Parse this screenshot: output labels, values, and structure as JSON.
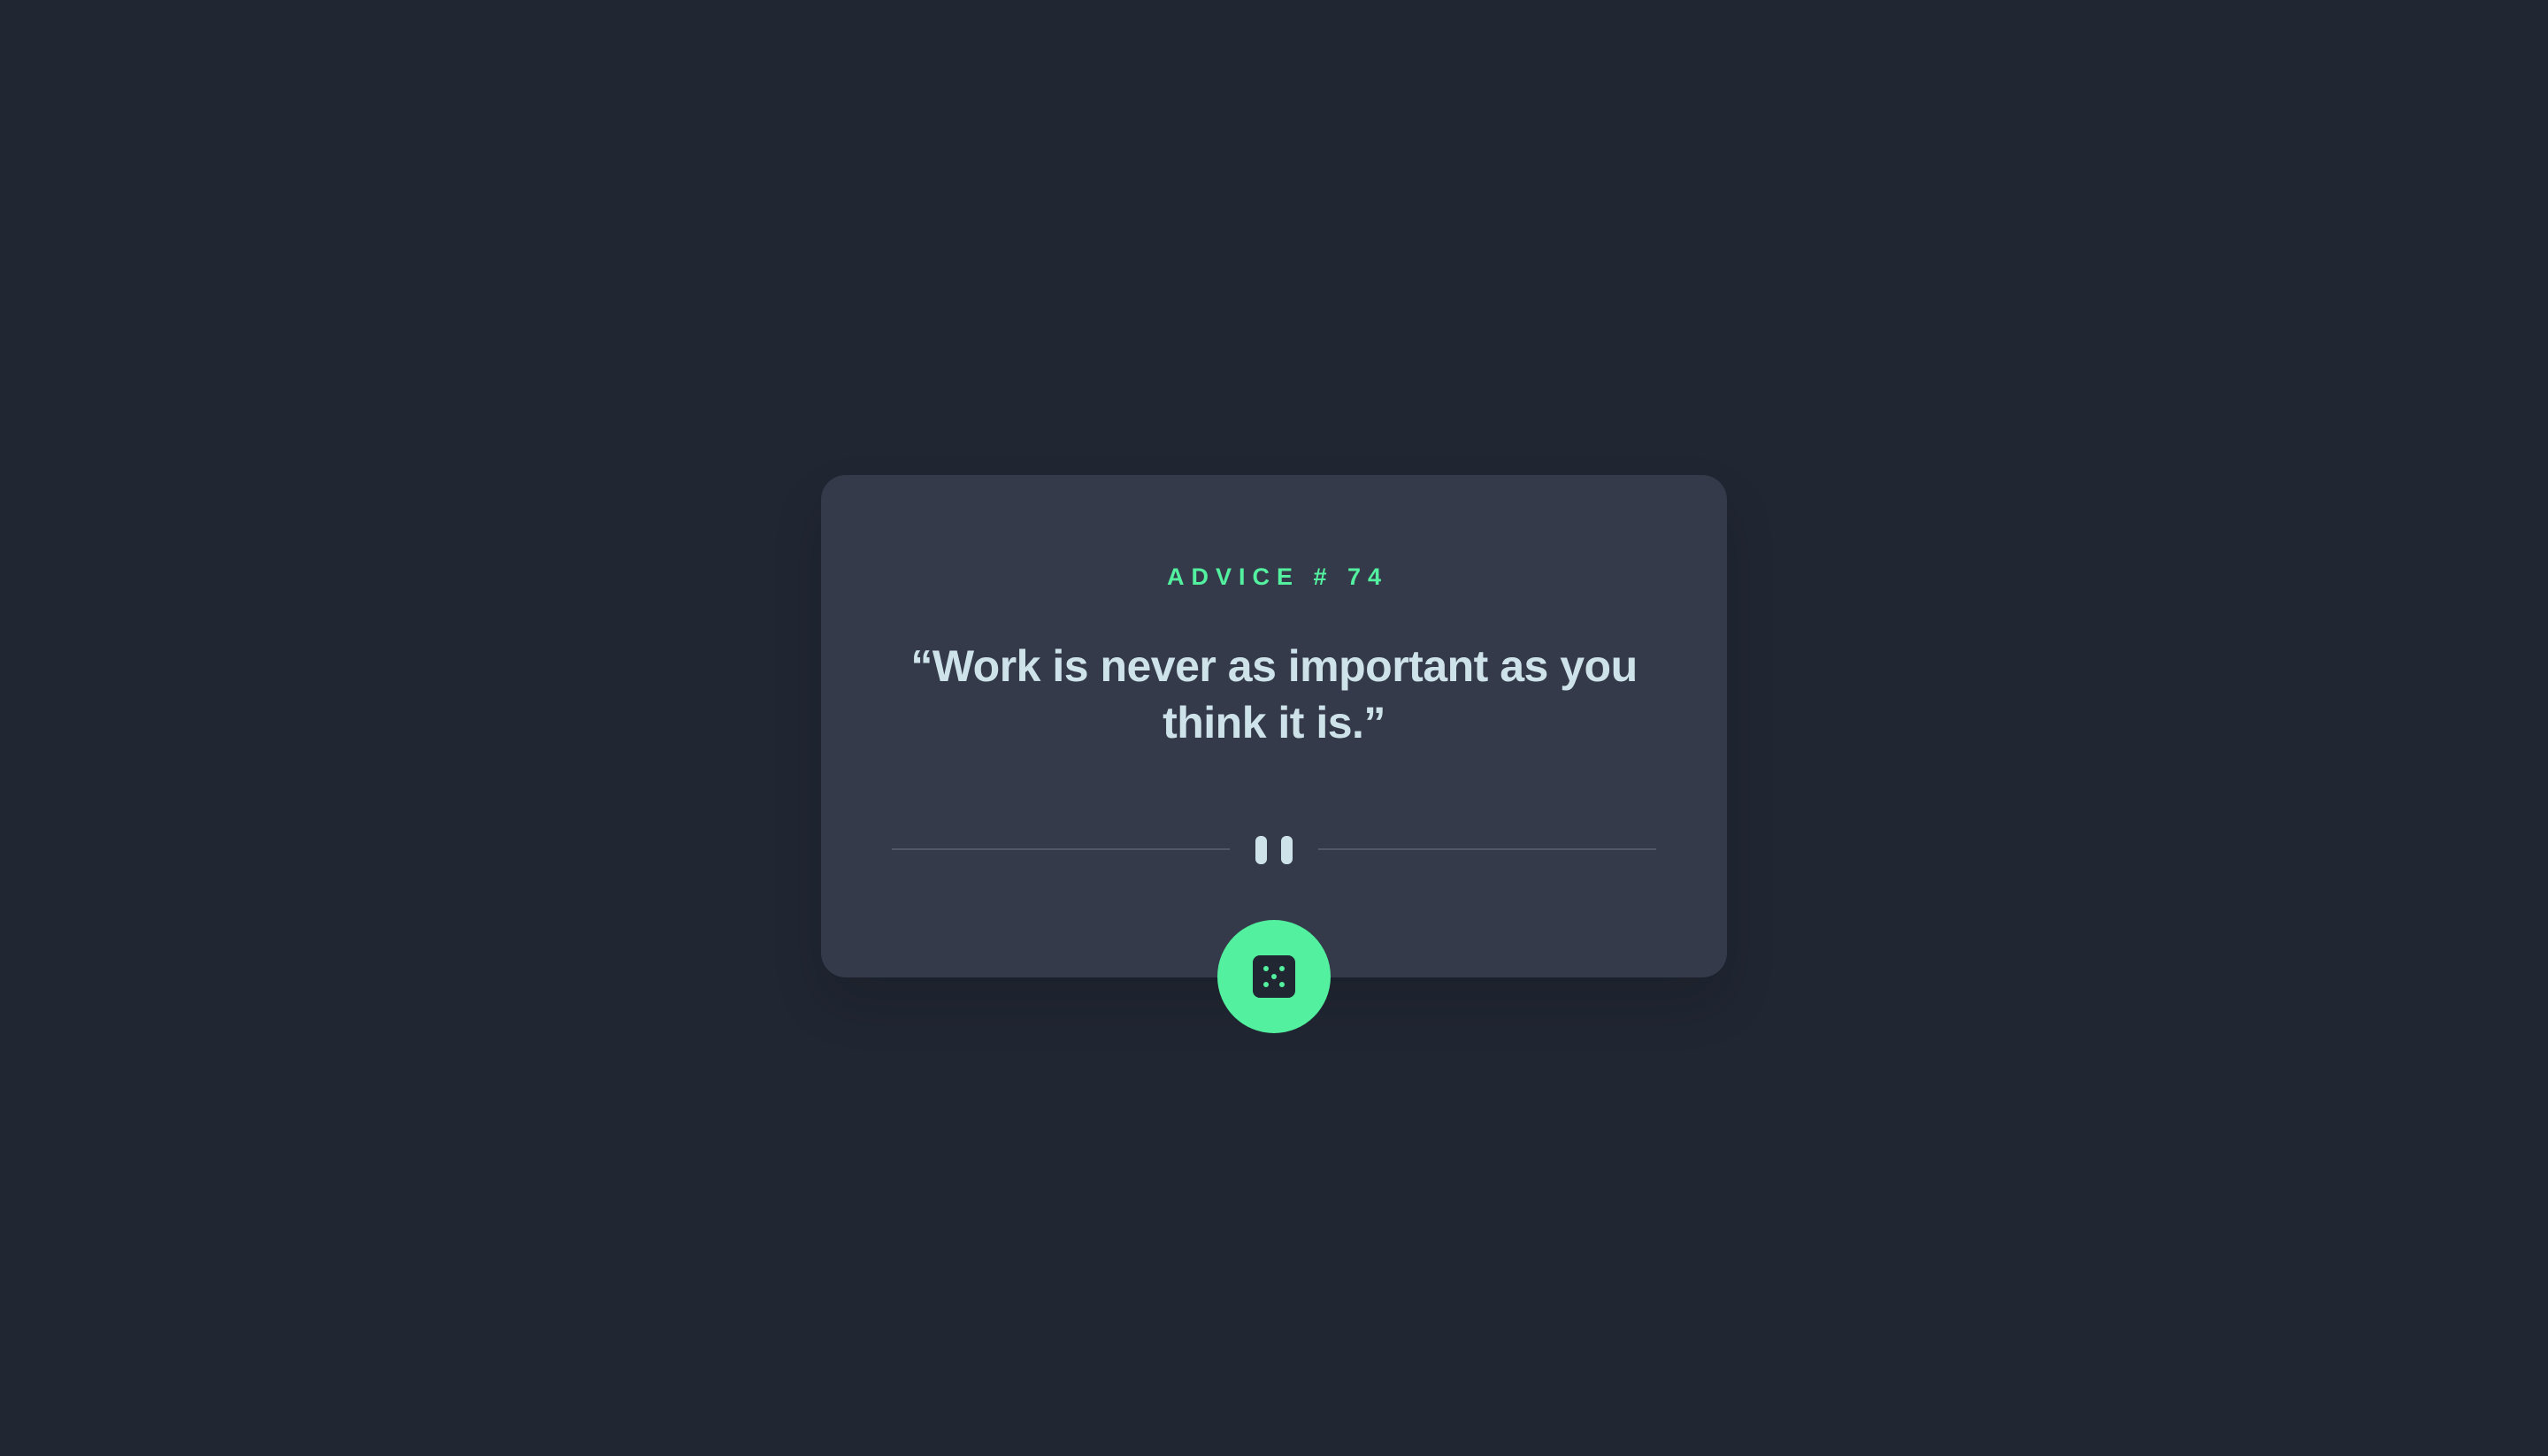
{
  "advice": {
    "id_label": "ADVICE # 74",
    "quote": "“Work is never as important as you think it is.”"
  },
  "colors": {
    "background": "#202632",
    "card": "#343a49",
    "accent": "#53f09f",
    "text": "#cee3e9",
    "divider": "#4e5868"
  },
  "icons": {
    "divider": "pause-icon",
    "button": "dice-icon"
  }
}
